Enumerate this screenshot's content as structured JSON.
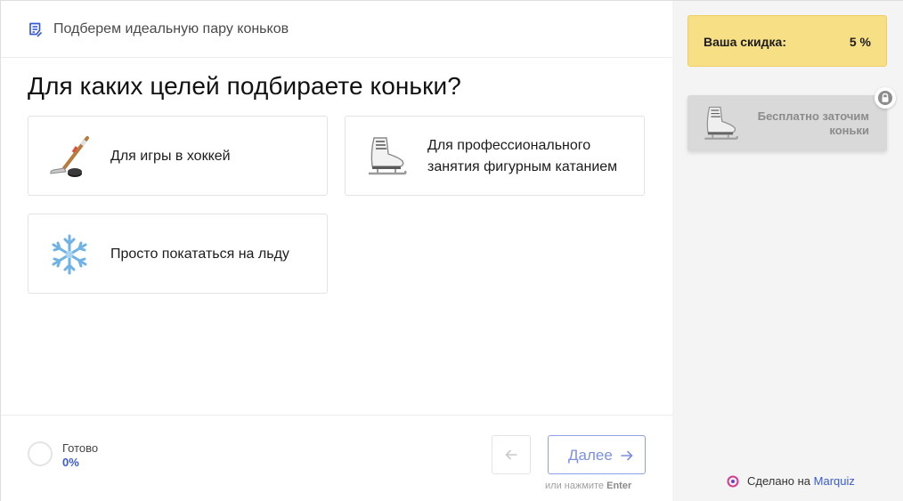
{
  "header": {
    "title": "Подберем идеальную пару коньков",
    "icon": "list-document-icon"
  },
  "question": "Для каких целей подбираете коньки?",
  "options": [
    {
      "label_line1": "Для игры в хоккей",
      "label_line2": "",
      "icon": "hockey-stick-icon"
    },
    {
      "label_line1": "Для профессионального",
      "label_line2": "занятия фигурным катанием",
      "icon": "ice-skate-icon"
    },
    {
      "label_line1": "Просто покататься на льду",
      "label_line2": "",
      "icon": "snowflake-icon"
    }
  ],
  "footer": {
    "progress_label": "Готово",
    "progress_value": "0%",
    "next_label": "Далее",
    "hint_prefix": "или нажмите",
    "hint_key": "Enter"
  },
  "sidebar": {
    "discount_label": "Ваша скидка:",
    "discount_value": "5 %",
    "bonus_text": "Бесплатно заточим коньки",
    "bonus_icon": "ice-skate-icon",
    "made_prefix": "Сделано на",
    "made_brand": "Marquiz"
  },
  "colors": {
    "accent": "#3a5bd0",
    "next_button": "#8fa1e6",
    "discount_bg": "#f7df86",
    "sidebar_bg": "#f4f4f4"
  }
}
